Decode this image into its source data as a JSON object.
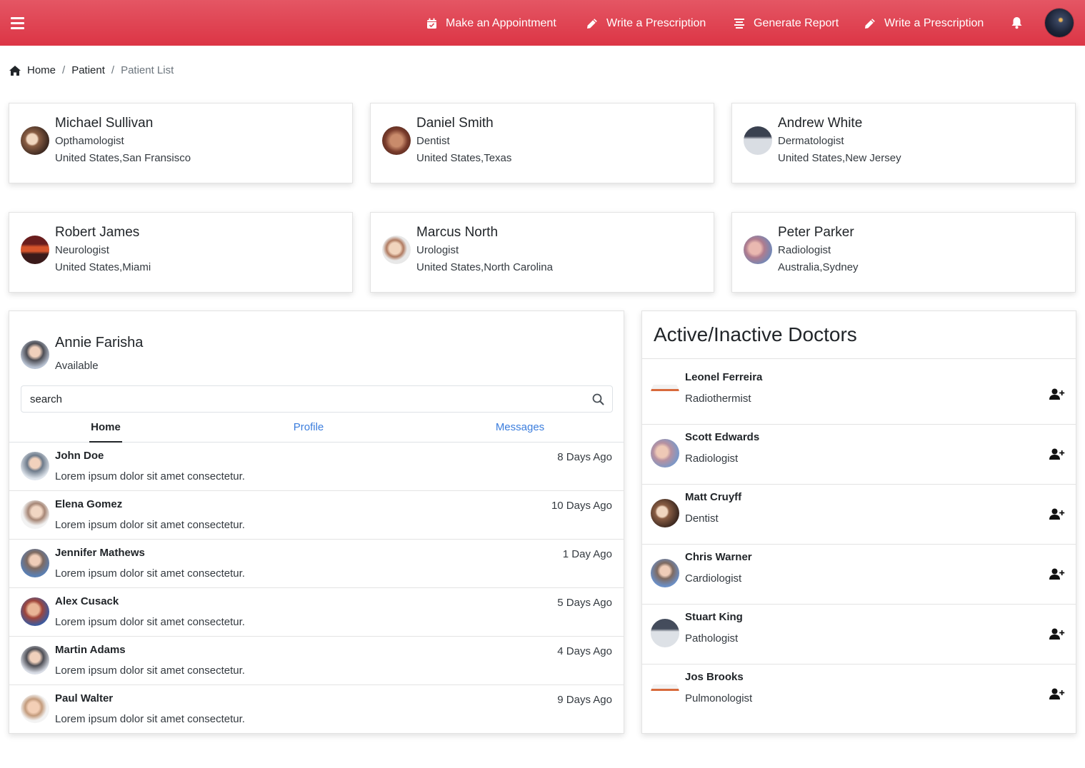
{
  "topbar": {
    "nav": [
      {
        "label": "Make an Appointment",
        "icon": "calendar-check-icon"
      },
      {
        "label": "Write a Prescription",
        "icon": "pencil-icon"
      },
      {
        "label": "Generate Report",
        "icon": "align-center-icon"
      },
      {
        "label": "Write a Prescription",
        "icon": "pencil-icon"
      }
    ],
    "accent": "#dc3545"
  },
  "breadcrumb": {
    "items": [
      "Home",
      "Patient"
    ],
    "current": "Patient List"
  },
  "doctor_cards": [
    {
      "name": "Michael Sullivan",
      "specialty": "Opthamologist",
      "location": "United States,San Fransisco"
    },
    {
      "name": "Daniel Smith",
      "specialty": "Dentist",
      "location": "United States,Texas"
    },
    {
      "name": "Andrew White",
      "specialty": "Dermatologist",
      "location": "United States,New Jersey"
    },
    {
      "name": "Robert James",
      "specialty": "Neurologist",
      "location": "United States,Miami"
    },
    {
      "name": "Marcus North",
      "specialty": "Urologist",
      "location": "United States,North Carolina"
    },
    {
      "name": "Peter Parker",
      "specialty": "Radiologist",
      "location": "Australia,Sydney"
    }
  ],
  "chat": {
    "user": {
      "name": "Annie Farisha",
      "status": "Available"
    },
    "search": {
      "value": "",
      "placeholder": "search"
    },
    "tabs": [
      "Home",
      "Profile",
      "Messages"
    ],
    "active_tab": "Home",
    "messages": [
      {
        "name": "John Doe",
        "text": "Lorem ipsum dolor sit amet consectetur.",
        "time": "8 Days Ago"
      },
      {
        "name": "Elena Gomez",
        "text": "Lorem ipsum dolor sit amet consectetur.",
        "time": "10 Days Ago"
      },
      {
        "name": "Jennifer Mathews",
        "text": "Lorem ipsum dolor sit amet consectetur.",
        "time": "1 Day Ago"
      },
      {
        "name": "Alex Cusack",
        "text": "Lorem ipsum dolor sit amet consectetur.",
        "time": "5 Days Ago"
      },
      {
        "name": "Martin Adams",
        "text": "Lorem ipsum dolor sit amet consectetur.",
        "time": "4 Days Ago"
      },
      {
        "name": "Paul Walter",
        "text": "Lorem ipsum dolor sit amet consectetur.",
        "time": "9 Days Ago"
      }
    ]
  },
  "doctors_panel": {
    "title": "Active/Inactive Doctors",
    "doctors": [
      {
        "name": "Leonel Ferreira",
        "specialty": "Radiothermist"
      },
      {
        "name": "Scott Edwards",
        "specialty": "Radiologist"
      },
      {
        "name": "Matt Cruyff",
        "specialty": "Dentist"
      },
      {
        "name": "Chris Warner",
        "specialty": "Cardiologist"
      },
      {
        "name": "Stuart King",
        "specialty": "Pathologist"
      },
      {
        "name": "Jos Brooks",
        "specialty": "Pulmonologist"
      }
    ]
  }
}
